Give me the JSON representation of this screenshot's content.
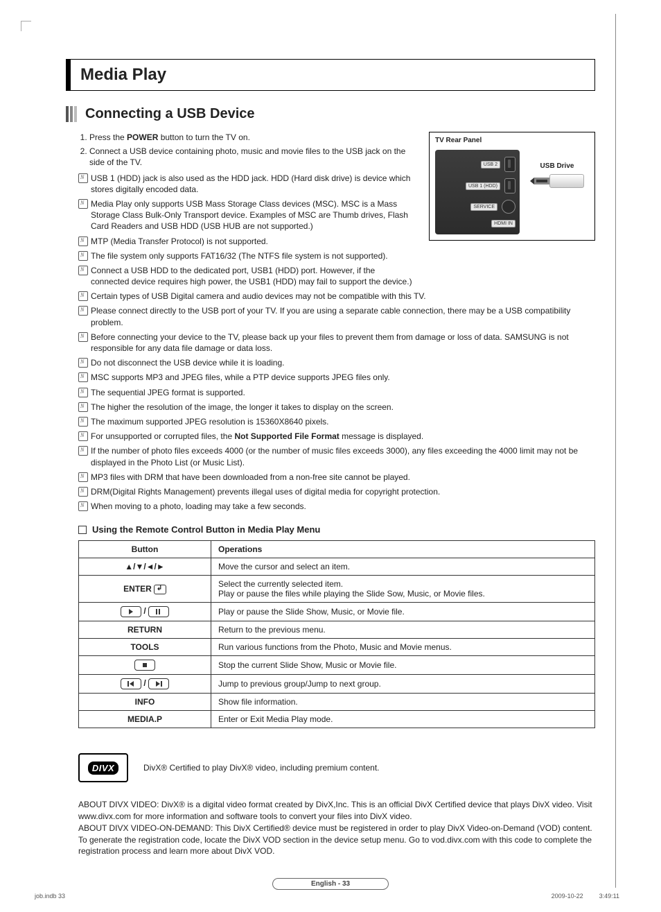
{
  "page": {
    "title": "Media Play",
    "section": "Connecting a USB Device",
    "footer": "English - 33",
    "meta_left": "job.indb   33",
    "meta_right": "2009-10-22      3:49:11"
  },
  "panel": {
    "title": "TV Rear Panel",
    "usb_drive": "USB Drive",
    "ports": [
      "USB 2",
      "USB 1 (HDD)",
      "SERVICE",
      "HDMI IN"
    ]
  },
  "steps": [
    {
      "pre": "Press the ",
      "bold": "POWER",
      "post": " button to turn the TV on."
    },
    {
      "text": "Connect a USB device containing photo, music and movie files to the USB jack on the side of the TV."
    }
  ],
  "notes": [
    {
      "text": "USB 1 (HDD) jack is also used as the HDD jack. HDD (Hard disk drive) is device which stores digitally encoded data.",
      "narrow": true
    },
    {
      "text": "Media Play only supports USB Mass Storage Class devices (MSC). MSC is a Mass Storage Class Bulk-Only Transport device. Examples of MSC are Thumb drives, Flash Card Readers and USB HDD (USB HUB are not supported.)",
      "narrow": true
    },
    {
      "text": "MTP (Media Transfer Protocol) is not supported.",
      "narrow": true
    },
    {
      "text": "The file system only supports FAT16/32 (The NTFS file system is not supported).",
      "narrow": true
    },
    {
      "text": "Connect a USB HDD to the dedicated port, USB1 (HDD) port. However, if the connected device requires high power, the USB1 (HDD) may fail to support the device.)",
      "narrow": true
    },
    {
      "text": "Certain types of USB Digital camera and audio devices may not be compatible with this TV."
    },
    {
      "text": "Please connect directly to the USB port of your TV. If you are using a separate cable connection, there may be a USB compatibility problem."
    },
    {
      "text": "Before connecting your device to the TV, please back up your files to prevent them from damage or loss of data. SAMSUNG is not responsible for any data file damage or data loss."
    },
    {
      "text": "Do not disconnect the USB device while it is loading."
    },
    {
      "text": "MSC supports MP3 and JPEG files, while a PTP device supports JPEG files only."
    },
    {
      "text": "The sequential JPEG format is supported."
    },
    {
      "text": "The higher the resolution of the image, the longer it takes to display on the screen."
    },
    {
      "text": "The maximum supported JPEG resolution is 15360X8640 pixels."
    },
    {
      "pre": "For unsupported or corrupted files, the ",
      "bold": "Not Supported File Format",
      "post": " message is displayed."
    },
    {
      "text": "If the number of photo files exceeds 4000 (or the number of music files exceeds 3000), any files exceeding the 4000 limit may not be displayed in the Photo List (or Music List)."
    },
    {
      "text": "MP3 files with DRM that have been downloaded from a non-free site cannot be played."
    },
    {
      "text": "DRM(Digital Rights Management) prevents illegal uses of digital media for copyright protection."
    },
    {
      "text": "When moving to a photo, loading may take a few seconds."
    }
  ],
  "table": {
    "heading": "Using the Remote Control Button in Media Play Menu",
    "head_button": "Button",
    "head_ops": "Operations",
    "rows": [
      {
        "btn_type": "arrows",
        "btn": "▲/▼/◄/►",
        "op": "Move the cursor and select an item."
      },
      {
        "btn_type": "enter",
        "btn": "ENTER",
        "op": "Select the currently selected item.\nPlay or pause the files while playing the Slide Sow, Music, or Movie files."
      },
      {
        "btn_type": "playpause",
        "op": "Play or pause the Slide Show, Music, or Movie file."
      },
      {
        "btn_type": "text",
        "btn": "RETURN",
        "op": "Return to the previous menu."
      },
      {
        "btn_type": "text",
        "btn": "TOOLS",
        "op": "Run various functions from the Photo, Music and Movie menus."
      },
      {
        "btn_type": "stop",
        "op": "Stop the current Slide Show, Music or Movie file."
      },
      {
        "btn_type": "prevnext",
        "op": "Jump to previous group/Jump to next group."
      },
      {
        "btn_type": "text",
        "btn": "INFO",
        "op": "Show file information."
      },
      {
        "btn_type": "text",
        "btn": "MEDIA.P",
        "op": "Enter or Exit Media Play mode."
      }
    ]
  },
  "divx": {
    "logo": "DIVX",
    "line": "DivX® Certified to play DivX® video, including premium content.",
    "about1": "ABOUT DIVX VIDEO: DivX® is a digital video format created by DivX,Inc. This is an official DivX Certified device that plays DivX video. Visit www.divx.com for more information and software tools to convert your files into DivX video.",
    "about2": "ABOUT DIVX VIDEO-ON-DEMAND: This DivX Certified® device must be registered in order to play DivX Video-on-Demand (VOD) content. To generate the registration code, locate the DivX VOD section in the device setup menu. Go to vod.divx.com with this code to complete the registration process and learn more about DivX VOD."
  }
}
